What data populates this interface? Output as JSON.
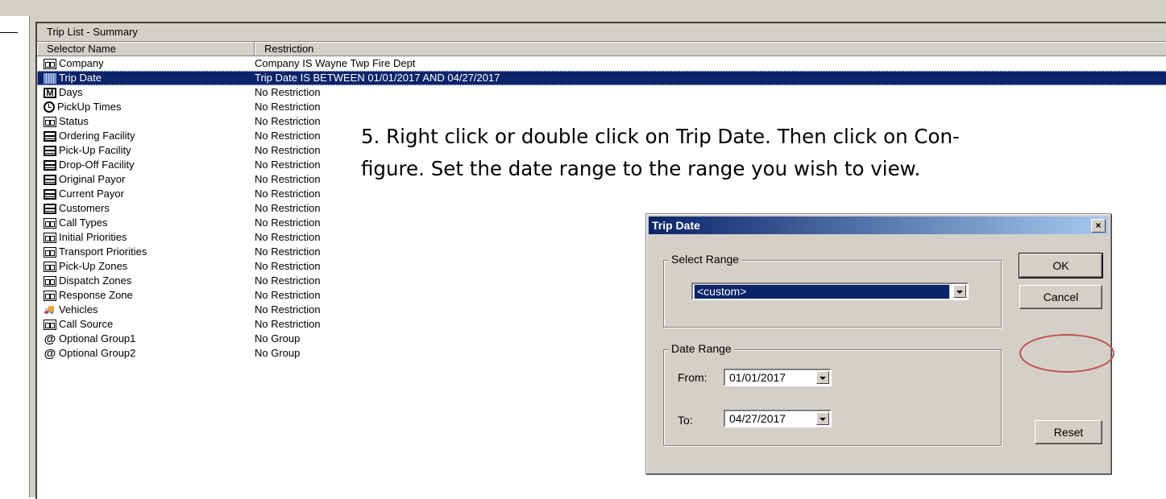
{
  "panel": {
    "title": "Trip List - Summary",
    "columns": [
      "Selector Name",
      "Restriction"
    ],
    "rows": [
      {
        "name": "Company",
        "restriction": "Company IS Wayne Twp Fire Dept",
        "icon": "grid-icon"
      },
      {
        "name": "Trip Date",
        "restriction": "Trip Date IS BETWEEN 01/01/2017 AND 04/27/2017",
        "icon": "date-icon",
        "selected": true
      },
      {
        "name": "Days",
        "restriction": "No Restriction",
        "icon": "m-icon"
      },
      {
        "name": "PickUp Times",
        "restriction": "No Restriction",
        "icon": "clock-icon"
      },
      {
        "name": "Status",
        "restriction": "No Restriction",
        "icon": "grid-icon"
      },
      {
        "name": "Ordering Facility",
        "restriction": "No Restriction",
        "icon": "calendar-icon"
      },
      {
        "name": "Pick-Up Facility",
        "restriction": "No Restriction",
        "icon": "calendar-icon"
      },
      {
        "name": "Drop-Off Facility",
        "restriction": "No Restriction",
        "icon": "calendar-icon"
      },
      {
        "name": "Original Payor",
        "restriction": "No Restriction",
        "icon": "calendar-icon"
      },
      {
        "name": "Current Payor",
        "restriction": "No Restriction",
        "icon": "calendar-icon"
      },
      {
        "name": "Customers",
        "restriction": "No Restriction",
        "icon": "calendar-icon"
      },
      {
        "name": "Call Types",
        "restriction": "No Restriction",
        "icon": "grid-icon"
      },
      {
        "name": "Initial Priorities",
        "restriction": "No Restriction",
        "icon": "grid-icon"
      },
      {
        "name": "Transport Priorities",
        "restriction": "No Restriction",
        "icon": "grid-icon"
      },
      {
        "name": "Pick-Up Zones",
        "restriction": "No Restriction",
        "icon": "grid-icon"
      },
      {
        "name": "Dispatch Zones",
        "restriction": "No Restriction",
        "icon": "grid-icon"
      },
      {
        "name": "Response Zone",
        "restriction": "No Restriction",
        "icon": "grid-icon"
      },
      {
        "name": "Vehicles",
        "restriction": "No Restriction",
        "icon": "vehicle-icon"
      },
      {
        "name": "Call Source",
        "restriction": "No Restriction",
        "icon": "grid-icon"
      },
      {
        "name": "Optional Group1",
        "restriction": "No Group",
        "icon": "at-icon"
      },
      {
        "name": "Optional Group2",
        "restriction": "No Group",
        "icon": "at-icon"
      }
    ]
  },
  "instruction": "5. Right click or double click on Trip Date.  Then click on Con-figure.  Set the date range to the range you wish to view.",
  "instruction_lines": [
    "5. Right click or double click on Trip Date.  Then click on Con-",
    "figure.  Set the date range to the range you wish to view."
  ],
  "dialog": {
    "title": "Trip Date",
    "close_label": "×",
    "select_range_label": "Select Range",
    "select_range_value": "<custom>",
    "date_range_label": "Date Range",
    "from_label": "From:",
    "from_value": "01/01/2017",
    "to_label": "To:",
    "to_value": "04/27/2017",
    "ok_label": "OK",
    "cancel_label": "Cancel",
    "reset_label": "Reset"
  },
  "colors": {
    "selection": "#0a246a",
    "annotation_ellipse": "#c0504d"
  }
}
